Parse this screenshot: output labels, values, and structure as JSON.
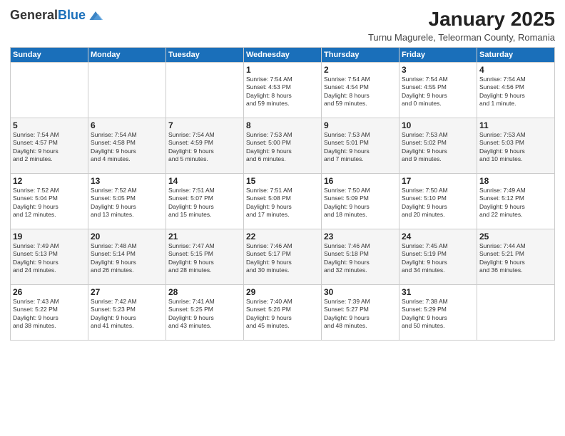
{
  "logo": {
    "general": "General",
    "blue": "Blue"
  },
  "title": "January 2025",
  "subtitle": "Turnu Magurele, Teleorman County, Romania",
  "headers": [
    "Sunday",
    "Monday",
    "Tuesday",
    "Wednesday",
    "Thursday",
    "Friday",
    "Saturday"
  ],
  "weeks": [
    [
      {
        "day": "",
        "info": ""
      },
      {
        "day": "",
        "info": ""
      },
      {
        "day": "",
        "info": ""
      },
      {
        "day": "1",
        "info": "Sunrise: 7:54 AM\nSunset: 4:53 PM\nDaylight: 8 hours\nand 59 minutes."
      },
      {
        "day": "2",
        "info": "Sunrise: 7:54 AM\nSunset: 4:54 PM\nDaylight: 8 hours\nand 59 minutes."
      },
      {
        "day": "3",
        "info": "Sunrise: 7:54 AM\nSunset: 4:55 PM\nDaylight: 9 hours\nand 0 minutes."
      },
      {
        "day": "4",
        "info": "Sunrise: 7:54 AM\nSunset: 4:56 PM\nDaylight: 9 hours\nand 1 minute."
      }
    ],
    [
      {
        "day": "5",
        "info": "Sunrise: 7:54 AM\nSunset: 4:57 PM\nDaylight: 9 hours\nand 2 minutes."
      },
      {
        "day": "6",
        "info": "Sunrise: 7:54 AM\nSunset: 4:58 PM\nDaylight: 9 hours\nand 4 minutes."
      },
      {
        "day": "7",
        "info": "Sunrise: 7:54 AM\nSunset: 4:59 PM\nDaylight: 9 hours\nand 5 minutes."
      },
      {
        "day": "8",
        "info": "Sunrise: 7:53 AM\nSunset: 5:00 PM\nDaylight: 9 hours\nand 6 minutes."
      },
      {
        "day": "9",
        "info": "Sunrise: 7:53 AM\nSunset: 5:01 PM\nDaylight: 9 hours\nand 7 minutes."
      },
      {
        "day": "10",
        "info": "Sunrise: 7:53 AM\nSunset: 5:02 PM\nDaylight: 9 hours\nand 9 minutes."
      },
      {
        "day": "11",
        "info": "Sunrise: 7:53 AM\nSunset: 5:03 PM\nDaylight: 9 hours\nand 10 minutes."
      }
    ],
    [
      {
        "day": "12",
        "info": "Sunrise: 7:52 AM\nSunset: 5:04 PM\nDaylight: 9 hours\nand 12 minutes."
      },
      {
        "day": "13",
        "info": "Sunrise: 7:52 AM\nSunset: 5:05 PM\nDaylight: 9 hours\nand 13 minutes."
      },
      {
        "day": "14",
        "info": "Sunrise: 7:51 AM\nSunset: 5:07 PM\nDaylight: 9 hours\nand 15 minutes."
      },
      {
        "day": "15",
        "info": "Sunrise: 7:51 AM\nSunset: 5:08 PM\nDaylight: 9 hours\nand 17 minutes."
      },
      {
        "day": "16",
        "info": "Sunrise: 7:50 AM\nSunset: 5:09 PM\nDaylight: 9 hours\nand 18 minutes."
      },
      {
        "day": "17",
        "info": "Sunrise: 7:50 AM\nSunset: 5:10 PM\nDaylight: 9 hours\nand 20 minutes."
      },
      {
        "day": "18",
        "info": "Sunrise: 7:49 AM\nSunset: 5:12 PM\nDaylight: 9 hours\nand 22 minutes."
      }
    ],
    [
      {
        "day": "19",
        "info": "Sunrise: 7:49 AM\nSunset: 5:13 PM\nDaylight: 9 hours\nand 24 minutes."
      },
      {
        "day": "20",
        "info": "Sunrise: 7:48 AM\nSunset: 5:14 PM\nDaylight: 9 hours\nand 26 minutes."
      },
      {
        "day": "21",
        "info": "Sunrise: 7:47 AM\nSunset: 5:15 PM\nDaylight: 9 hours\nand 28 minutes."
      },
      {
        "day": "22",
        "info": "Sunrise: 7:46 AM\nSunset: 5:17 PM\nDaylight: 9 hours\nand 30 minutes."
      },
      {
        "day": "23",
        "info": "Sunrise: 7:46 AM\nSunset: 5:18 PM\nDaylight: 9 hours\nand 32 minutes."
      },
      {
        "day": "24",
        "info": "Sunrise: 7:45 AM\nSunset: 5:19 PM\nDaylight: 9 hours\nand 34 minutes."
      },
      {
        "day": "25",
        "info": "Sunrise: 7:44 AM\nSunset: 5:21 PM\nDaylight: 9 hours\nand 36 minutes."
      }
    ],
    [
      {
        "day": "26",
        "info": "Sunrise: 7:43 AM\nSunset: 5:22 PM\nDaylight: 9 hours\nand 38 minutes."
      },
      {
        "day": "27",
        "info": "Sunrise: 7:42 AM\nSunset: 5:23 PM\nDaylight: 9 hours\nand 41 minutes."
      },
      {
        "day": "28",
        "info": "Sunrise: 7:41 AM\nSunset: 5:25 PM\nDaylight: 9 hours\nand 43 minutes."
      },
      {
        "day": "29",
        "info": "Sunrise: 7:40 AM\nSunset: 5:26 PM\nDaylight: 9 hours\nand 45 minutes."
      },
      {
        "day": "30",
        "info": "Sunrise: 7:39 AM\nSunset: 5:27 PM\nDaylight: 9 hours\nand 48 minutes."
      },
      {
        "day": "31",
        "info": "Sunrise: 7:38 AM\nSunset: 5:29 PM\nDaylight: 9 hours\nand 50 minutes."
      },
      {
        "day": "",
        "info": ""
      }
    ]
  ]
}
